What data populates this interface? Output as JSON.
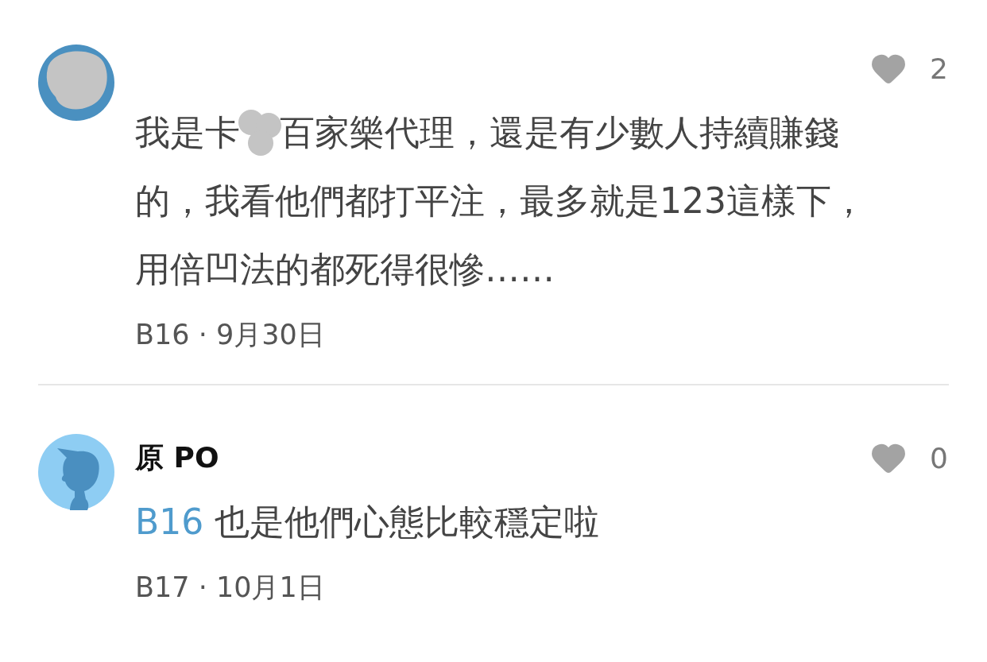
{
  "comments": [
    {
      "avatar": {
        "kind": "redacted"
      },
      "likes": "2",
      "lines": [
        [
          {
            "kind": "text",
            "text": "我是卡"
          },
          {
            "kind": "redaction"
          },
          {
            "kind": "text",
            "text": "百家樂代理，還是有少數人持續賺錢"
          }
        ],
        [
          {
            "kind": "text",
            "text": "的，我看他們都打平注，最多就是123這樣下，"
          }
        ],
        [
          {
            "kind": "text",
            "text": "用倍凹法的都死得很慘……"
          }
        ]
      ],
      "meta": "B16 · 9月30日"
    },
    {
      "avatar": {
        "kind": "silhouette"
      },
      "author": "原 PO",
      "likes": "0",
      "lines": [
        [
          {
            "kind": "mention",
            "text": "B16"
          },
          {
            "kind": "text",
            "text": "也是他們心態比較穩定啦"
          }
        ]
      ],
      "meta": "B17 · 10月1日"
    }
  ]
}
